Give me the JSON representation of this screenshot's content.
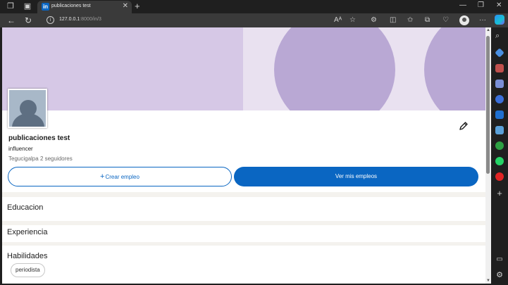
{
  "browser": {
    "tab_title": "publicaciones test",
    "tab_favicon_text": "in",
    "url_host": "127.0.0.1",
    "url_rest": ":8000/in/3",
    "icons": [
      "workspaces-icon",
      "tab-actions-icon",
      "back-icon",
      "refresh-icon",
      "info-icon",
      "read-aloud-icon",
      "favorite-icon",
      "extensions-icon",
      "split-screen-icon",
      "favorites-icon",
      "collections-icon",
      "performance-icon",
      "profile-icon",
      "more-icon",
      "copilot-icon"
    ]
  },
  "profile": {
    "name": "publicaciones test",
    "headline": "influencer",
    "location": "Tegucigalpa",
    "followers": "2 seguidores",
    "create_job_plus": "+",
    "create_job": "Crear empleo",
    "view_jobs": "Ver mis empleos"
  },
  "sections": {
    "education": "Educacion",
    "experience": "Experiencia",
    "skills": "Habilidades",
    "skill_items": [
      "periodista"
    ]
  },
  "colors": {
    "accent": "#0a66c2",
    "banner": "#d6c8e6",
    "banner_circle": "#b9a8d4"
  }
}
